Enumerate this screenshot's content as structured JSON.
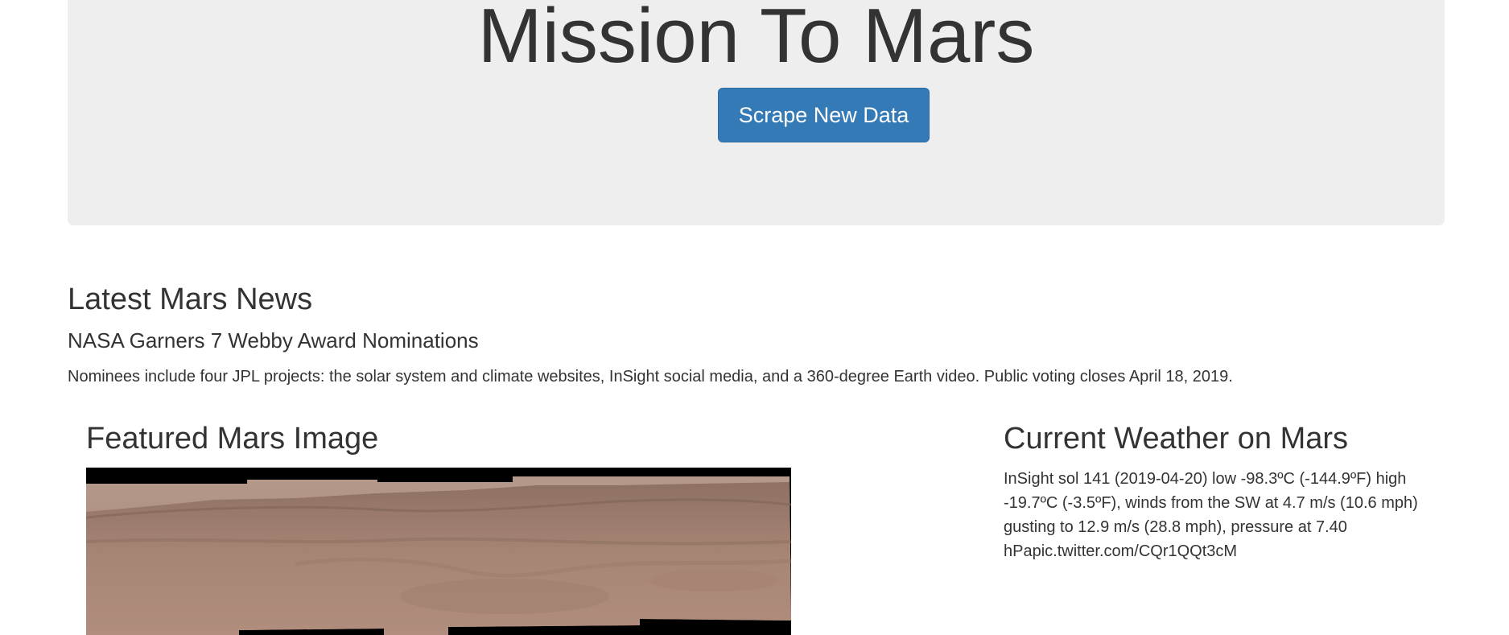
{
  "header": {
    "title": "Mission To Mars",
    "scrape_button_label": "Scrape New Data"
  },
  "news": {
    "heading": "Latest Mars News",
    "title": "NASA Garners 7 Webby Award Nominations",
    "paragraph": "Nominees include four JPL projects: the solar system and climate websites, InSight social media, and a 360-degree Earth video. Public voting closes April 18, 2019."
  },
  "featured": {
    "heading": "Featured Mars Image"
  },
  "weather": {
    "heading": "Current Weather on Mars",
    "text": "InSight sol 141 (2019-04-20) low -98.3ºC (-144.9ºF) high -19.7ºC (-3.5ºF), winds from the SW at 4.7 m/s (10.6 mph) gusting to 12.9 m/s (28.8 mph), pressure at 7.40 hPapic.twitter.com/CQr1QQt3cM"
  },
  "colors": {
    "jumbotron_bg": "#eeeeee",
    "button_primary": "#337ab7",
    "text": "#333333"
  }
}
